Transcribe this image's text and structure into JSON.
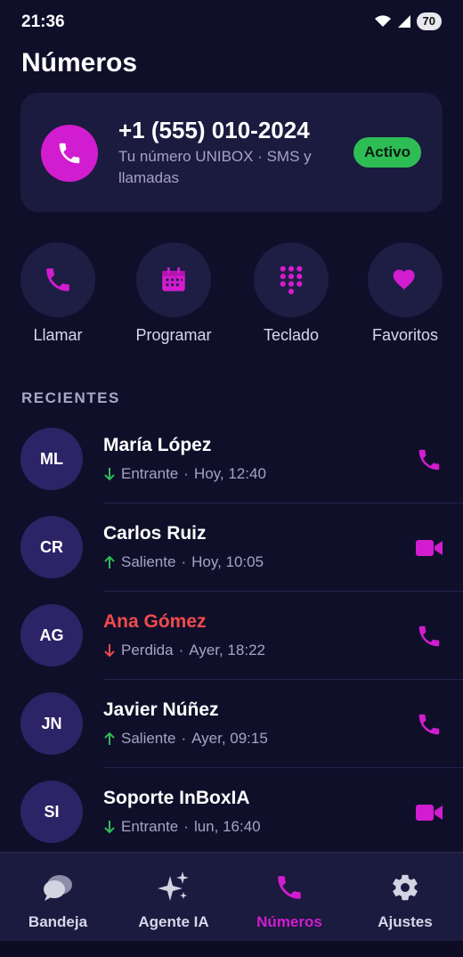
{
  "status_bar": {
    "time": "21:36",
    "battery": "70"
  },
  "page_title": "Números",
  "number_card": {
    "number": "+1 (555) 010-2024",
    "description": "Tu número UNIBOX · SMS y llamadas",
    "status": "Activo"
  },
  "quick_actions": [
    {
      "label": "Llamar",
      "icon": "phone-icon"
    },
    {
      "label": "Programar",
      "icon": "calendar-icon"
    },
    {
      "label": "Teclado",
      "icon": "dialpad-icon"
    },
    {
      "label": "Favoritos",
      "icon": "heart-icon"
    }
  ],
  "section_title": "RECIENTES",
  "recents": [
    {
      "initials": "ML",
      "name": "María López",
      "direction": "Entrante",
      "time": "Hoy, 12:40",
      "call_type": "phone",
      "missed": false
    },
    {
      "initials": "CR",
      "name": "Carlos Ruiz",
      "direction": "Saliente",
      "time": "Hoy, 10:05",
      "call_type": "video",
      "missed": false
    },
    {
      "initials": "AG",
      "name": "Ana Gómez",
      "direction": "Perdida",
      "time": "Ayer, 18:22",
      "call_type": "phone",
      "missed": true
    },
    {
      "initials": "JN",
      "name": "Javier Núñez",
      "direction": "Saliente",
      "time": "Ayer, 09:15",
      "call_type": "phone",
      "missed": false
    },
    {
      "initials": "SI",
      "name": "Soporte InBoxIA",
      "direction": "Entrante",
      "time": "lun, 16:40",
      "call_type": "video",
      "missed": false
    }
  ],
  "nav": [
    {
      "label": "Bandeja",
      "icon": "chat-bubbles-icon"
    },
    {
      "label": "Agente IA",
      "icon": "sparkles-icon"
    },
    {
      "label": "Números",
      "icon": "phone-icon",
      "active": true
    },
    {
      "label": "Ajustes",
      "icon": "gear-icon"
    }
  ],
  "colors": {
    "accent": "#d21ccf",
    "background": "#100f2a",
    "card": "#1b1a3f",
    "success": "#2ebd55",
    "missed": "#ef4b4b"
  }
}
